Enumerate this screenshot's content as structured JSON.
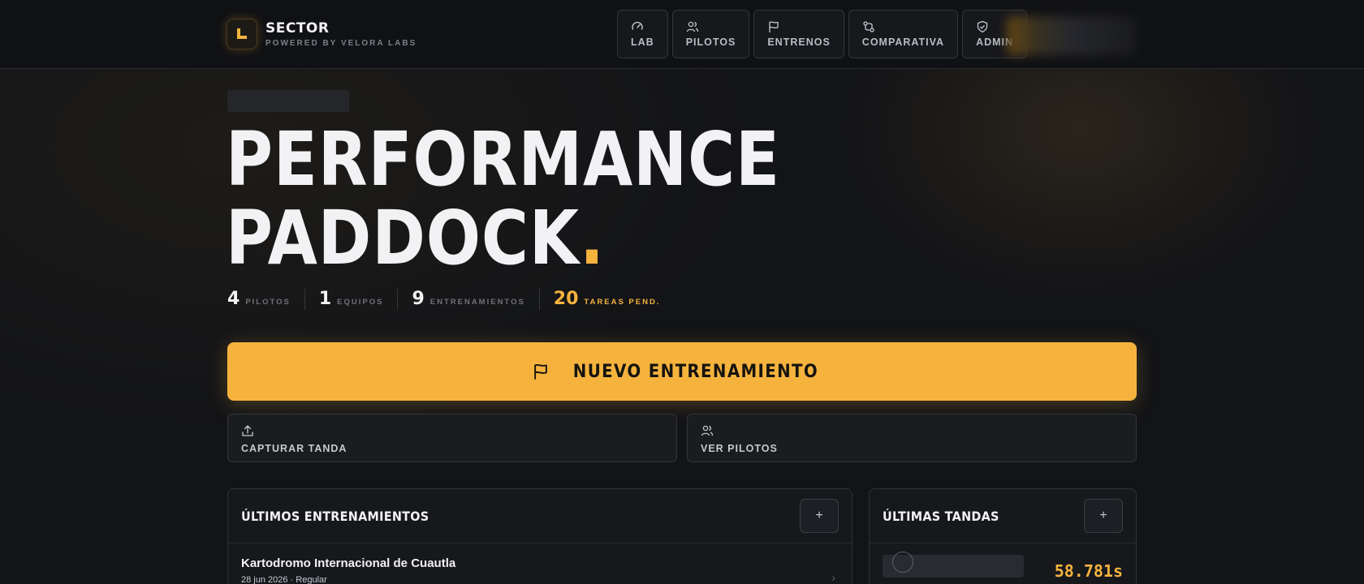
{
  "brand": {
    "name": "SECTOR",
    "tagline": "POWERED BY VELORA LABS"
  },
  "nav": {
    "items": [
      {
        "label": "LAB",
        "icon": "gauge-icon"
      },
      {
        "label": "PILOTOS",
        "icon": "users-icon"
      },
      {
        "label": "ENTRENOS",
        "icon": "flag-icon"
      },
      {
        "label": "COMPARATIVA",
        "icon": "compare-icon"
      },
      {
        "label": "ADMIN",
        "icon": "shield-icon"
      }
    ]
  },
  "hero": {
    "line1": "PERFORMANCE",
    "line2": "PADDOCK",
    "dot": "."
  },
  "stats": [
    {
      "value": "4",
      "label": "PILOTOS"
    },
    {
      "value": "1",
      "label": "EQUIPOS"
    },
    {
      "value": "9",
      "label": "ENTRENAMIENTOS"
    },
    {
      "value": "20",
      "label": "TAREAS PEND."
    }
  ],
  "actions": {
    "primary_label": "NUEVO ENTRENAMIENTO",
    "capture_label": "CAPTURAR TANDA",
    "pilots_label": "VER PILOTOS"
  },
  "panels": {
    "trainings": {
      "title": "ÚLTIMOS ENTRENAMIENTOS",
      "add_label": "+",
      "items": [
        {
          "title": "Kartodromo Internacional de Cuautla",
          "subtitle": "28 jun 2026 · Regular"
        }
      ]
    },
    "laps": {
      "title": "ÚLTIMAS TANDAS",
      "add_label": "+",
      "items": [
        {
          "time": "58.781s"
        }
      ]
    }
  },
  "colors": {
    "accent": "#f5b33e",
    "background": "#131417",
    "text": "#f2f2f4"
  }
}
